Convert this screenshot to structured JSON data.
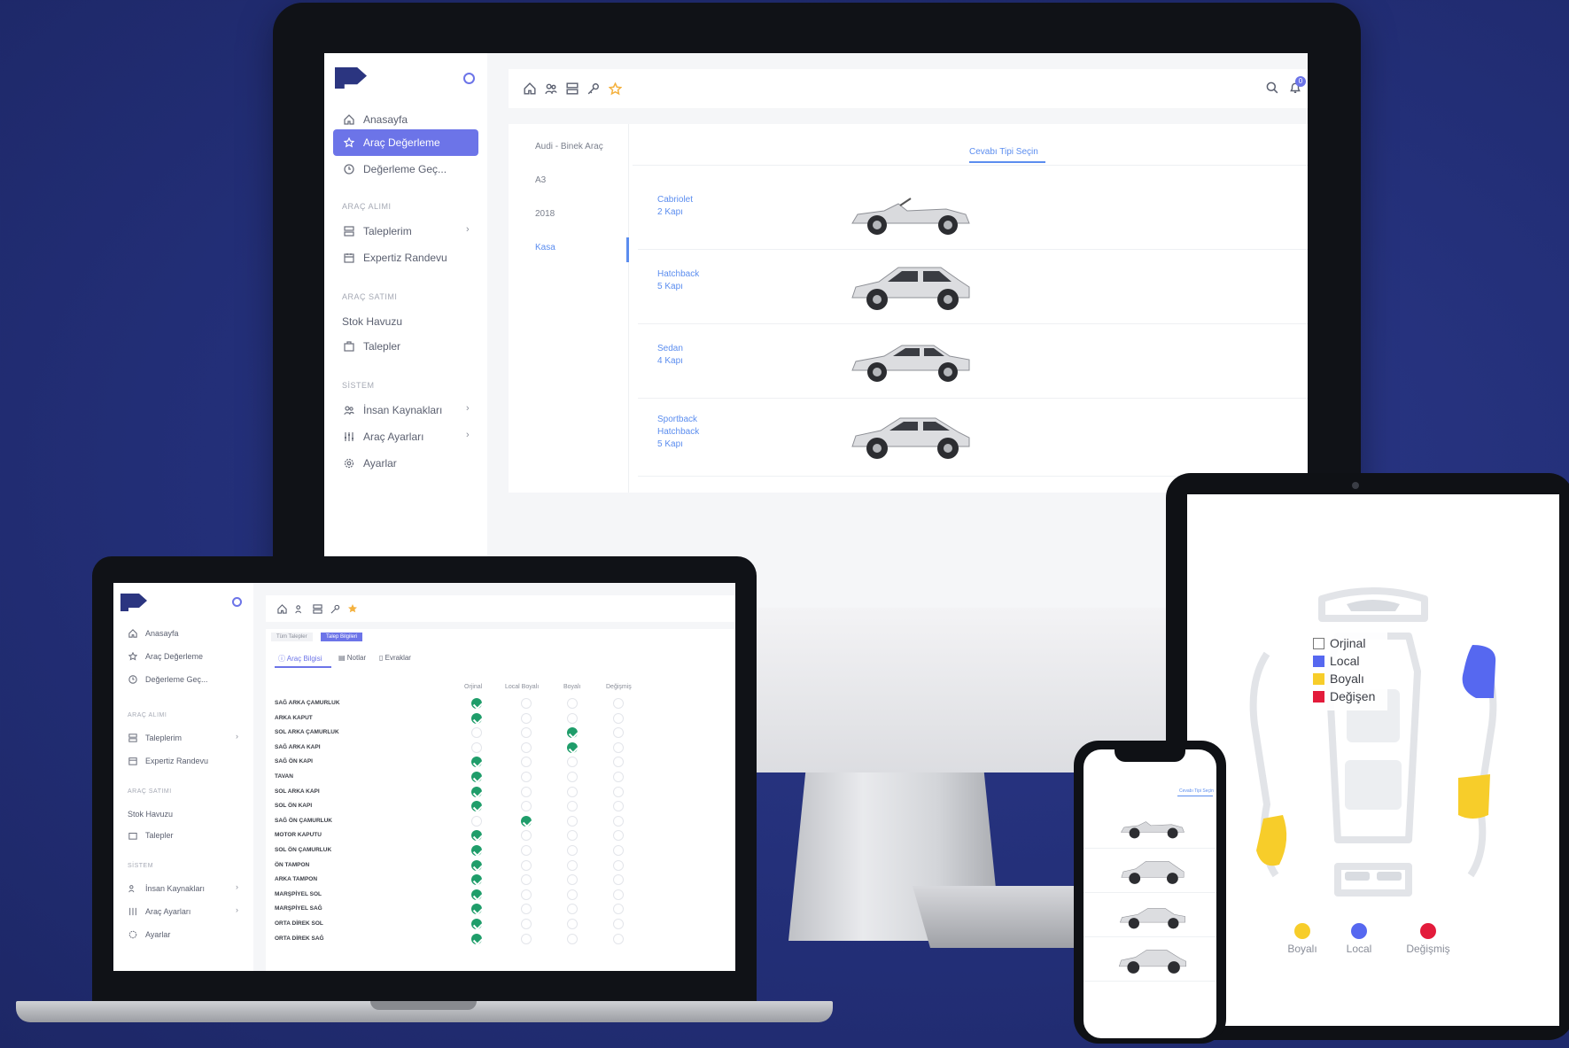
{
  "colors": {
    "background": "#232f78",
    "accent": "#6c74e8",
    "link": "#5b8def",
    "check": "#1f9d6a",
    "star": "#f4b13e",
    "local": "#5668f0",
    "boyali": "#f7cd2a",
    "degisen": "#e31b3b"
  },
  "desktop": {
    "sidebar": {
      "items": [
        {
          "label": "Anasayfa",
          "icon": "home-icon"
        },
        {
          "label": "Araç Değerleme",
          "icon": "star-icon",
          "active": true
        },
        {
          "label": "Değerleme Geç...",
          "icon": "clock-icon"
        }
      ],
      "section_arac_alimi": "ARAÇ ALIMI",
      "alimi_items": [
        {
          "label": "Taleplerim",
          "icon": "list-icon"
        },
        {
          "label": "Expertiz Randevu",
          "icon": "calendar-icon"
        }
      ],
      "section_arac_satimi": "ARAÇ SATIMI",
      "satimi_items": [
        {
          "label": "Stok Havuzu"
        },
        {
          "label": "Talepler",
          "icon": "bag-icon"
        }
      ],
      "section_sistem": "SİSTEM",
      "sistem_items": [
        {
          "label": "İnsan Kaynakları",
          "icon": "users-icon"
        },
        {
          "label": "Araç Ayarları",
          "icon": "sliders-icon"
        },
        {
          "label": "Ayarlar",
          "icon": "gear-icon"
        }
      ]
    },
    "steps": [
      "Audi - Binek Araç",
      "A3",
      "2018",
      "Kasa"
    ],
    "tab_label": "Cevabı Tipi Seçin",
    "bodies": [
      {
        "line1": "Cabriolet",
        "line2": "2 Kapı",
        "line3": ""
      },
      {
        "line1": "Hatchback",
        "line2": "5 Kapı",
        "line3": ""
      },
      {
        "line1": "Sedan",
        "line2": "4 Kapı",
        "line3": ""
      },
      {
        "line1": "Sportback",
        "line2": "Hatchback",
        "line3": "5 Kapı"
      }
    ],
    "notification_count": "0"
  },
  "laptop": {
    "sidebar": {
      "items": [
        "Anasayfa",
        "Araç Değerleme",
        "Değerleme Geç..."
      ],
      "section_arac_alimi": "ARAÇ ALIMI",
      "alimi_items": [
        "Taleplerim",
        "Expertiz Randevu"
      ],
      "section_arac_satimi": "ARAÇ SATIMI",
      "satimi_items": [
        "Stok Havuzu",
        "Talepler"
      ],
      "section_sistem": "SİSTEM",
      "sistem_items": [
        "İnsan Kaynakları",
        "Araç Ayarları",
        "Ayarlar"
      ]
    },
    "top_tabs": [
      "Tüm Talepler",
      "Talep Bilgileri"
    ],
    "sub_tabs": [
      "Araç Bilgisi",
      "Notlar",
      "Evraklar"
    ],
    "columns": [
      "Orjinal",
      "Local Boyalı",
      "Boyalı",
      "Değişmiş"
    ],
    "rows": [
      {
        "part": "SAĞ ARKA ÇAMURLUK",
        "status": 0
      },
      {
        "part": "ARKA KAPUT",
        "status": 0
      },
      {
        "part": "SOL ARKA ÇAMURLUK",
        "status": 2
      },
      {
        "part": "SAĞ ARKA KAPI",
        "status": 2
      },
      {
        "part": "SAĞ ÖN KAPI",
        "status": 0
      },
      {
        "part": "TAVAN",
        "status": 0
      },
      {
        "part": "SOL ARKA KAPI",
        "status": 0
      },
      {
        "part": "SOL ÖN KAPI",
        "status": 0
      },
      {
        "part": "SAĞ ÖN ÇAMURLUK",
        "status": 1
      },
      {
        "part": "MOTOR KAPUTU",
        "status": 0
      },
      {
        "part": "SOL ÖN ÇAMURLUK",
        "status": 0
      },
      {
        "part": "ÖN TAMPON",
        "status": 0
      },
      {
        "part": "ARKA TAMPON",
        "status": 0
      },
      {
        "part": "MARŞPİYEL SOL",
        "status": 0
      },
      {
        "part": "MARŞPİYEL SAĞ",
        "status": 0
      },
      {
        "part": "ORTA DİREK SOL",
        "status": 0
      },
      {
        "part": "ORTA DİREK SAĞ",
        "status": 0
      }
    ]
  },
  "tablet": {
    "legend": [
      {
        "label": "Orjinal",
        "color": "#ffffff"
      },
      {
        "label": "Local",
        "color": "#5668f0"
      },
      {
        "label": "Boyalı",
        "color": "#f7cd2a"
      },
      {
        "label": "Değişen",
        "color": "#e31b3b"
      }
    ],
    "bottom_legend": [
      {
        "label": "Boyalı",
        "color": "#f7cd2a"
      },
      {
        "label": "Local",
        "color": "#5668f0"
      },
      {
        "label": "Değişmiş",
        "color": "#e31b3b"
      }
    ]
  },
  "phone": {
    "tab_label": "Cevabı Tipi Seçin"
  }
}
